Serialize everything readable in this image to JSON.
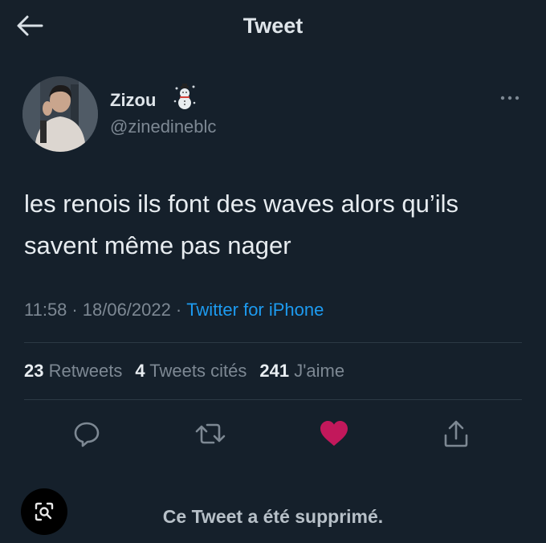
{
  "header": {
    "title": "Tweet"
  },
  "author": {
    "display_name": "Zizou",
    "handle": "@zinedineblc"
  },
  "tweet": {
    "text": "les renois ils font des waves alors qu’ils savent même pas nager",
    "time": "11:58",
    "date": "18/06/2022",
    "separator": "·",
    "source": "Twitter for iPhone"
  },
  "stats": {
    "retweets_count": "23",
    "retweets_label": "Retweets",
    "quotes_count": "4",
    "quotes_label": "Tweets cités",
    "likes_count": "241",
    "likes_label": "J'aime"
  },
  "icons": {
    "back": "arrow-left-icon",
    "emoji": "snowman-icon",
    "more": "more-horizontal-icon",
    "reply": "reply-icon",
    "retweet": "retweet-icon",
    "like": "heart-icon",
    "share": "share-icon",
    "lens": "lens-search-icon"
  },
  "colors": {
    "background": "#15202b",
    "link": "#1d9bf0",
    "like": "#f91880",
    "muted": "#7d8893"
  },
  "footer": {
    "deleted_notice": "Ce Tweet a été supprimé."
  }
}
